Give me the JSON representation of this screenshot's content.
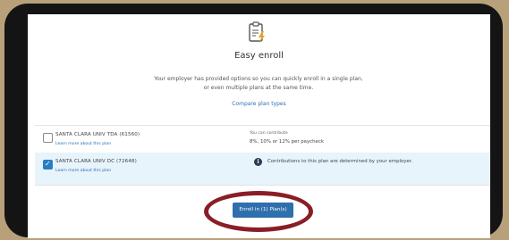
{
  "header": {
    "icon": "clipboard-lightning-icon",
    "title": "Easy enroll",
    "description": "Your employer has provided options so you can quickly enroll in a single plan, or even multiple plans at the same time.",
    "compare_link": "Compare plan types"
  },
  "plans": [
    {
      "name": "SANTA CLARA UNIV TDA (61560)",
      "link": "Learn more about this plan",
      "checked": false,
      "contribution_label": "You can contribute",
      "contribution_value": "8%, 10% or 12% per paycheck"
    },
    {
      "name": "SANTA CLARA UNIV DC (72648)",
      "link": "Learn more about this plan",
      "checked": true,
      "info_text": "Contributions to this plan are determined by your employer."
    }
  ],
  "actions": {
    "enroll_label": "Enroll in (1) Plan(s)"
  },
  "colors": {
    "accent": "#2f6fad",
    "selected_row": "#e7f4fb",
    "highlight_ring": "#8a1e26"
  }
}
